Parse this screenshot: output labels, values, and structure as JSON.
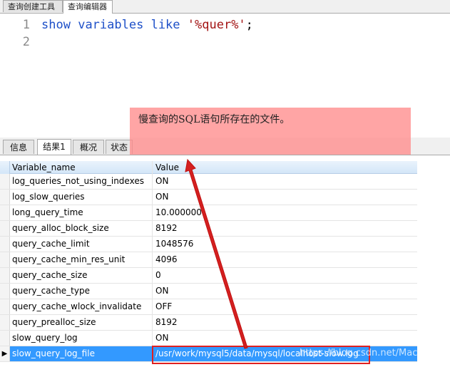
{
  "editor_tabs": [
    {
      "label": "查询创建工具",
      "active": false
    },
    {
      "label": "查询编辑器",
      "active": true
    }
  ],
  "editor": {
    "line_numbers": [
      "1",
      "2"
    ],
    "line1": {
      "kw1": "show",
      "kw2": "variables",
      "kw3": "like",
      "str": "'%quer%'",
      "end": ";"
    }
  },
  "result_tabs": [
    {
      "label": "信息",
      "active": false
    },
    {
      "label": "结果1",
      "active": true
    },
    {
      "label": "概况",
      "active": false
    },
    {
      "label": "状态",
      "active": false
    }
  ],
  "grid": {
    "columns": [
      "Variable_name",
      "Value"
    ],
    "rows": [
      [
        "log_queries_not_using_indexes",
        "ON"
      ],
      [
        "log_slow_queries",
        "ON"
      ],
      [
        "long_query_time",
        "10.000000"
      ],
      [
        "query_alloc_block_size",
        "8192"
      ],
      [
        "query_cache_limit",
        "1048576"
      ],
      [
        "query_cache_min_res_unit",
        "4096"
      ],
      [
        "query_cache_size",
        "0"
      ],
      [
        "query_cache_type",
        "ON"
      ],
      [
        "query_cache_wlock_invalidate",
        "OFF"
      ],
      [
        "query_prealloc_size",
        "8192"
      ],
      [
        "slow_query_log",
        "ON"
      ],
      [
        "slow_query_log_file",
        "/usr/work/mysql5/data/mysql/localhost-slow.log"
      ]
    ],
    "selected_row": 11,
    "row_indicator": "▶"
  },
  "annotation": {
    "text": "慢查询的SQL语句所存在的文件。"
  },
  "watermark": "https://blog.csdn.net/MacWx",
  "colors": {
    "selection": "#3399ff",
    "keyword": "#1e50c8",
    "string": "#a31515",
    "annotation": "#ff8c8c",
    "highlight": "#e02020"
  }
}
